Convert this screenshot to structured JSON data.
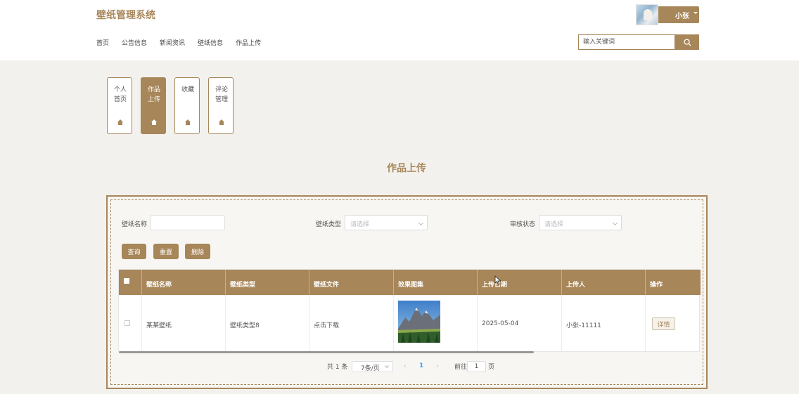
{
  "brand": "壁纸管理系统",
  "nav": [
    "首页",
    "公告信息",
    "新闻资讯",
    "壁纸信息",
    "作品上传"
  ],
  "user": {
    "name": "小张"
  },
  "search": {
    "placeholder": "输入关键词"
  },
  "side_tabs": [
    {
      "label": "个人首页",
      "active": false
    },
    {
      "label": "作品上传",
      "active": true
    },
    {
      "label": "收藏",
      "active": false
    },
    {
      "label": "评论管理",
      "active": false
    }
  ],
  "page_title": "作品上传",
  "filters": {
    "name_label": "壁纸名称",
    "name_value": "",
    "type_label": "壁纸类型",
    "type_placeholder": "请选择",
    "status_label": "审核状态",
    "status_placeholder": "请选择"
  },
  "buttons": {
    "query": "查询",
    "reset": "重置",
    "delete": "删除"
  },
  "table": {
    "columns": [
      "壁纸名称",
      "壁纸类型",
      "壁纸文件",
      "效果图集",
      "上传日期",
      "上传人",
      "操作"
    ],
    "rows": [
      {
        "name": "某某壁纸",
        "type": "壁纸类型8",
        "file": "点击下载",
        "date": "2025-05-04",
        "uploader": "小张-11111",
        "action": "详情"
      }
    ]
  },
  "pager": {
    "total": "共 1 条",
    "page_size": "7条/页",
    "prev": "‹",
    "current": "1",
    "next": "›",
    "goto_label": "前往",
    "goto_value": "1",
    "page_suffix": "页"
  },
  "colors": {
    "accent": "#a7865a",
    "background": "#f3f1ed",
    "link": "#409eff"
  }
}
